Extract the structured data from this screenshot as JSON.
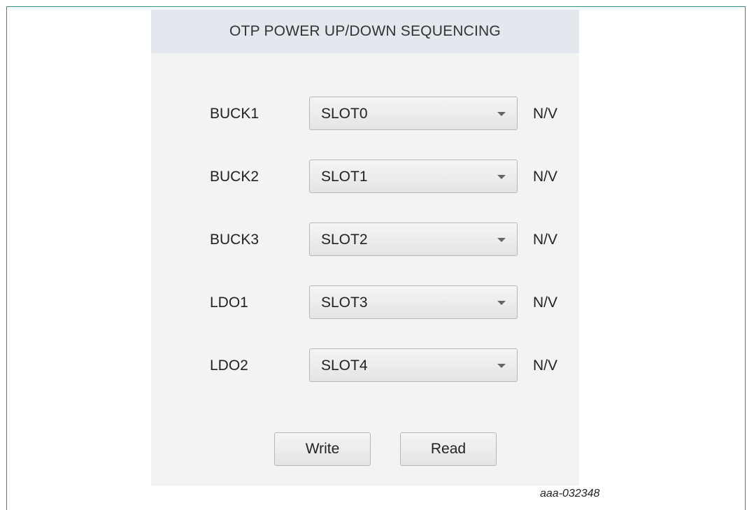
{
  "panel": {
    "title": "OTP POWER UP/DOWN SEQUENCING"
  },
  "rows": [
    {
      "label": "BUCK1",
      "selected": "SLOT0",
      "unit": "N/V"
    },
    {
      "label": "BUCK2",
      "selected": "SLOT1",
      "unit": "N/V"
    },
    {
      "label": "BUCK3",
      "selected": "SLOT2",
      "unit": "N/V"
    },
    {
      "label": "LDO1",
      "selected": "SLOT3",
      "unit": "N/V"
    },
    {
      "label": "LDO2",
      "selected": "SLOT4",
      "unit": "N/V"
    }
  ],
  "buttons": {
    "write_label": "Write",
    "read_label": "Read"
  },
  "figure": {
    "id": "aaa-032348"
  },
  "icons": {
    "dropdown": "chevron-down-icon"
  },
  "colors": {
    "frame_border": "#2f8f85",
    "header_bg": "#e3e8ee",
    "panel_bg": "#f3f3f3"
  }
}
